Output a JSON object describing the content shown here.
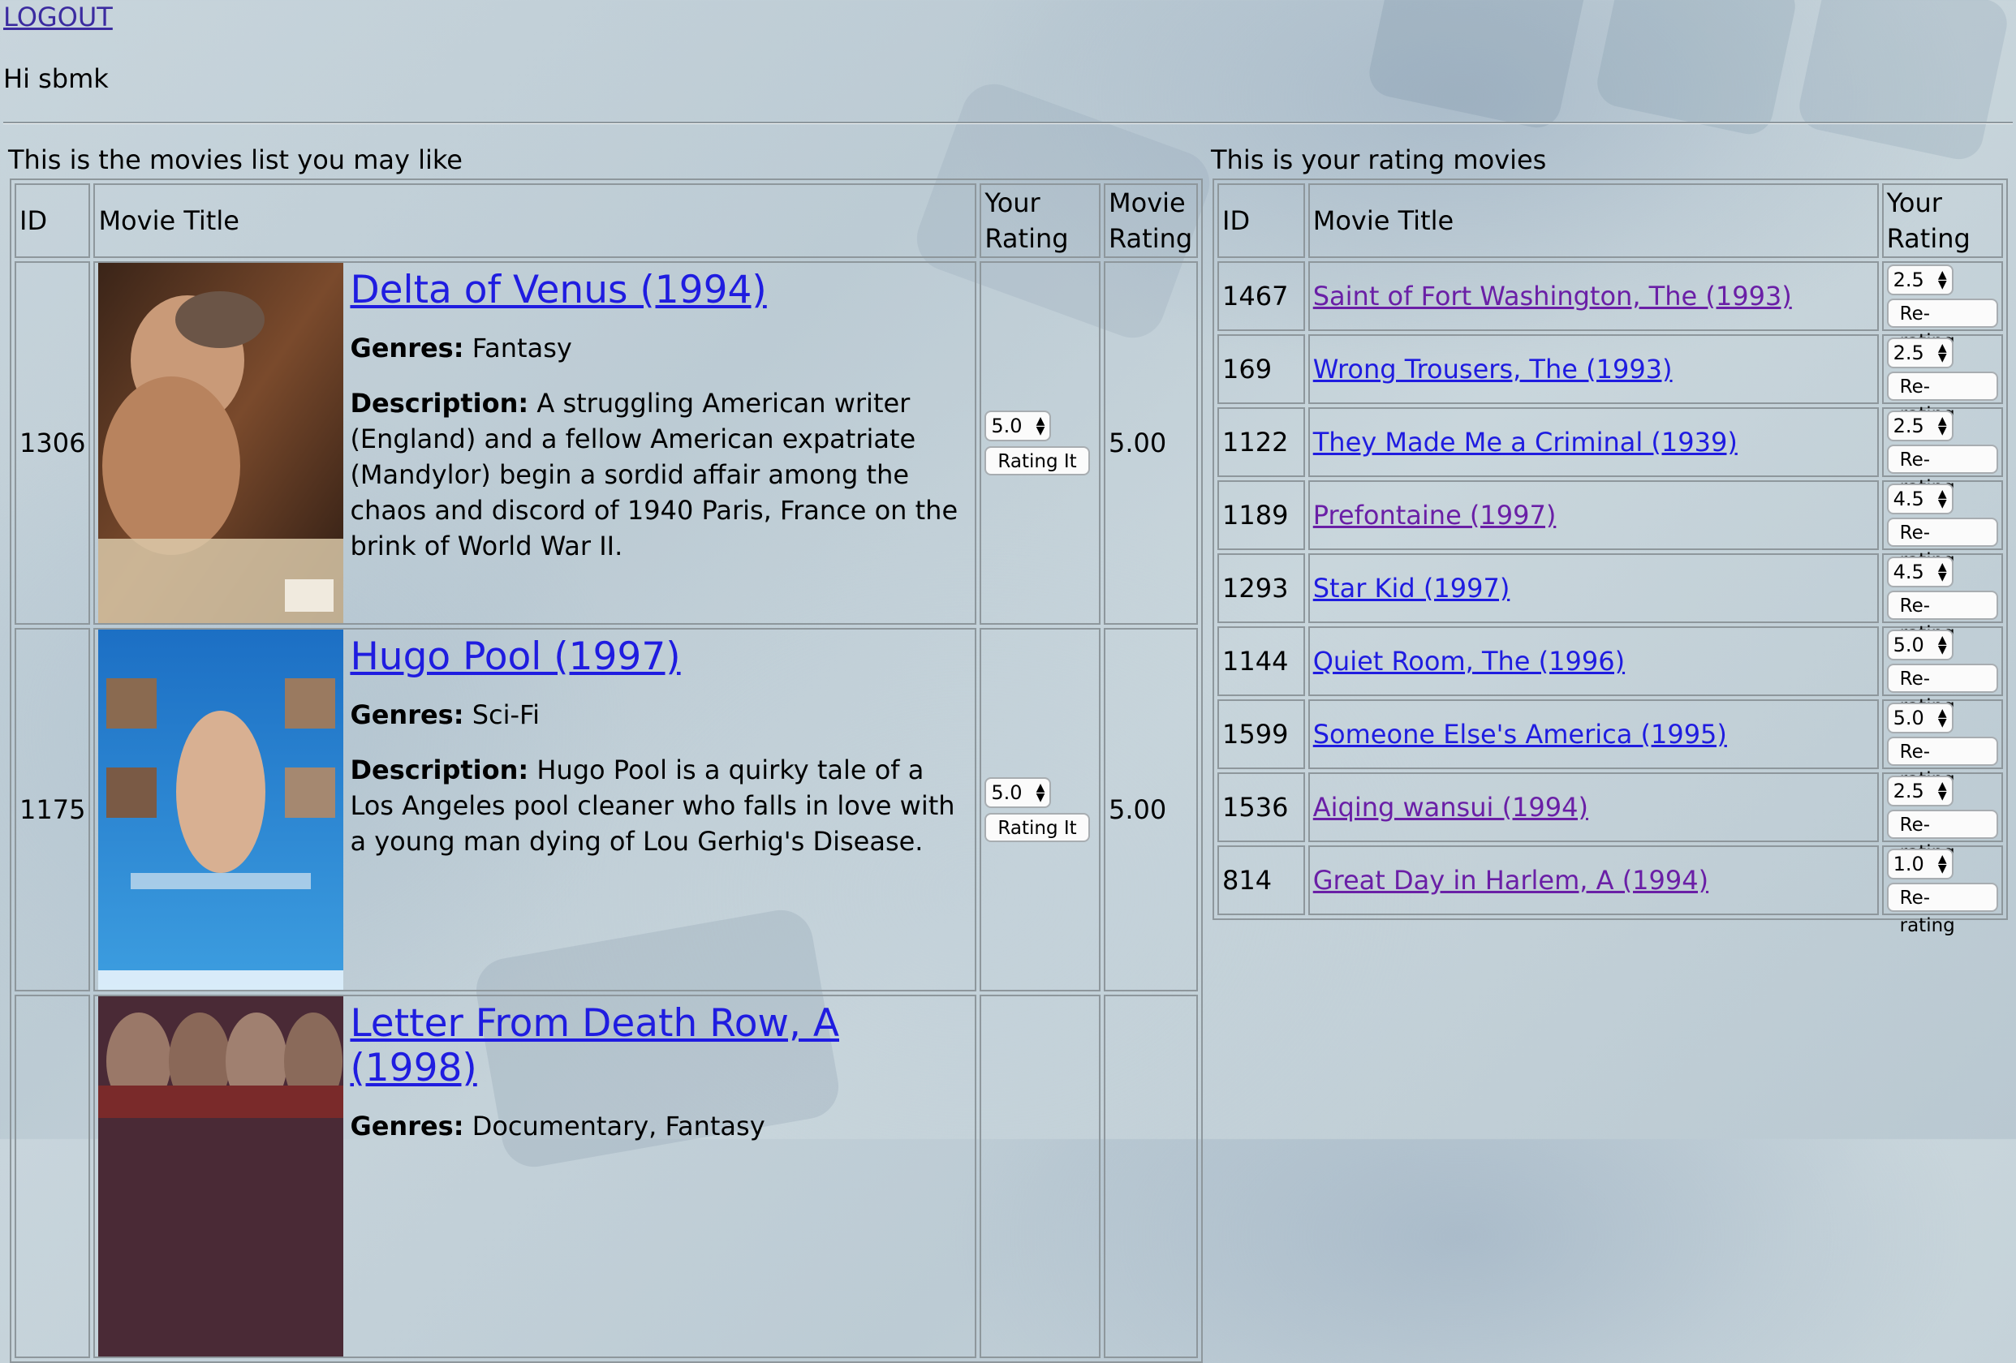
{
  "header": {
    "logout_label": "LOGOUT",
    "greeting": "Hi sbmk"
  },
  "recommended": {
    "caption": "This is the movies list you may like",
    "columns": [
      "ID",
      "Movie Title",
      "Your Rating",
      "Movie Rating"
    ],
    "rows": [
      {
        "id": "1306",
        "title": "Delta of Venus (1994)",
        "genres_label": "Genres:",
        "genres": "Fantasy",
        "description_label": "Description:",
        "description": "A struggling American writer (England) and a fellow American expatriate (Mandylor) begin a sordid affair among the chaos and discord of 1940 Paris, France on the brink of World War II.",
        "your_rating": "5.0",
        "button_label": "Rating It",
        "movie_rating": "5.00"
      },
      {
        "id": "1175",
        "title": "Hugo Pool (1997)",
        "genres_label": "Genres:",
        "genres": "Sci-Fi",
        "description_label": "Description:",
        "description": "Hugo Pool is a quirky tale of a Los Angeles pool cleaner who falls in love with a young man dying of Lou Gerhig's Disease.",
        "your_rating": "5.0",
        "button_label": "Rating It",
        "movie_rating": "5.00"
      },
      {
        "id": "",
        "title": "Letter From Death Row, A (1998)",
        "genres_label": "Genres:",
        "genres": "Documentary, Fantasy"
      }
    ]
  },
  "rated": {
    "caption": "This is your rating movies",
    "columns": [
      "ID",
      "Movie Title",
      "Your Rating"
    ],
    "button_label": "Re-rating",
    "rows": [
      {
        "id": "1467",
        "title": "Saint of Fort Washington, The (1993)",
        "rating": "2.5",
        "visited": true
      },
      {
        "id": "169",
        "title": "Wrong Trousers, The (1993)",
        "rating": "2.5",
        "visited": false
      },
      {
        "id": "1122",
        "title": "They Made Me a Criminal (1939)",
        "rating": "2.5",
        "visited": false
      },
      {
        "id": "1189",
        "title": "Prefontaine (1997)",
        "rating": "4.5",
        "visited": true
      },
      {
        "id": "1293",
        "title": "Star Kid (1997)",
        "rating": "4.5",
        "visited": false
      },
      {
        "id": "1144",
        "title": "Quiet Room, The (1996)",
        "rating": "5.0",
        "visited": false
      },
      {
        "id": "1599",
        "title": "Someone Else's America (1995)",
        "rating": "5.0",
        "visited": false
      },
      {
        "id": "1536",
        "title": "Aiqing wansui (1994)",
        "rating": "2.5",
        "visited": true
      },
      {
        "id": "814",
        "title": "Great Day in Harlem, A (1994)",
        "rating": "1.0",
        "visited": true
      }
    ]
  },
  "colors": {
    "link_unvisited": "#1f1ce0",
    "link_visited": "#6a1fa6",
    "border": "#8e979c"
  }
}
